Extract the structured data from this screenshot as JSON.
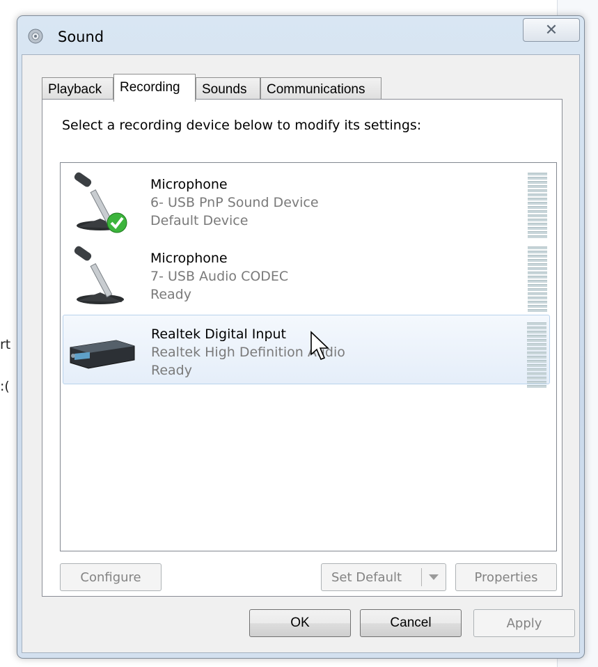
{
  "background": {
    "left_text_1": "rt",
    "left_text_2": ":("
  },
  "window": {
    "title": "Sound",
    "close_glyph": "✕"
  },
  "tabs": [
    {
      "label": "Playback"
    },
    {
      "label": "Recording"
    },
    {
      "label": "Sounds"
    },
    {
      "label": "Communications"
    }
  ],
  "active_tab": "Recording",
  "instruction": "Select a recording device below to modify its settings:",
  "devices": [
    {
      "name": "Microphone",
      "description": "6- USB PnP Sound Device",
      "status": "Default Device",
      "icon": "microphone-icon",
      "default": true
    },
    {
      "name": "Microphone",
      "description": "7- USB Audio CODEC",
      "status": "Ready",
      "icon": "microphone-icon",
      "default": false
    },
    {
      "name": "Realtek Digital Input",
      "description": "Realtek High Definition Audio",
      "status": "Ready",
      "icon": "digital-input-icon",
      "selected": true
    }
  ],
  "buttons": {
    "configure": "Configure",
    "set_default": "Set Default",
    "properties": "Properties",
    "ok": "OK",
    "cancel": "Cancel",
    "apply": "Apply"
  },
  "colors": {
    "selection": "#e5eef9",
    "check_green": "#3cb43c",
    "meter": "#c9d6da"
  }
}
